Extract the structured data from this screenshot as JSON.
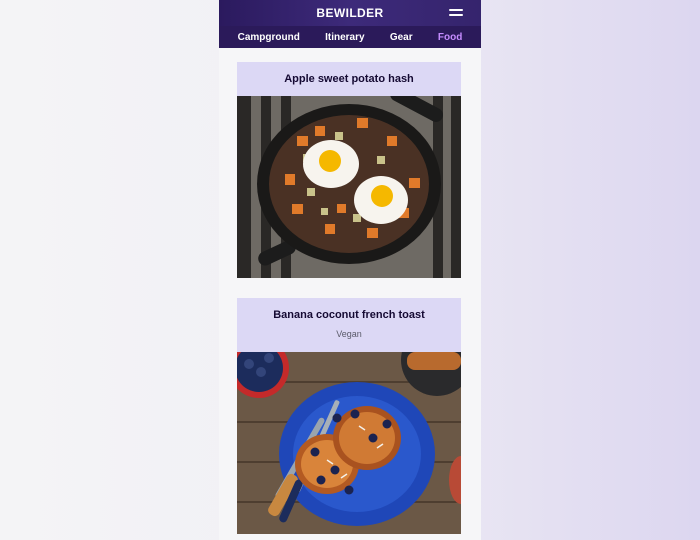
{
  "header": {
    "logo": "BEWILDER",
    "menu_icon": "hamburger-menu-icon"
  },
  "nav": {
    "items": [
      {
        "label": "Campground",
        "active": false
      },
      {
        "label": "Itinerary",
        "active": false
      },
      {
        "label": "Gear",
        "active": false
      },
      {
        "label": "Food",
        "active": true
      }
    ]
  },
  "recipes": [
    {
      "title": "Apple sweet potato hash",
      "subtitle": ""
    },
    {
      "title": "Banana coconut french toast",
      "subtitle": "Vegan"
    }
  ],
  "colors": {
    "brand": "#2b1a5e",
    "nav_active": "#c58cff",
    "card_header": "#dcd8f5"
  }
}
